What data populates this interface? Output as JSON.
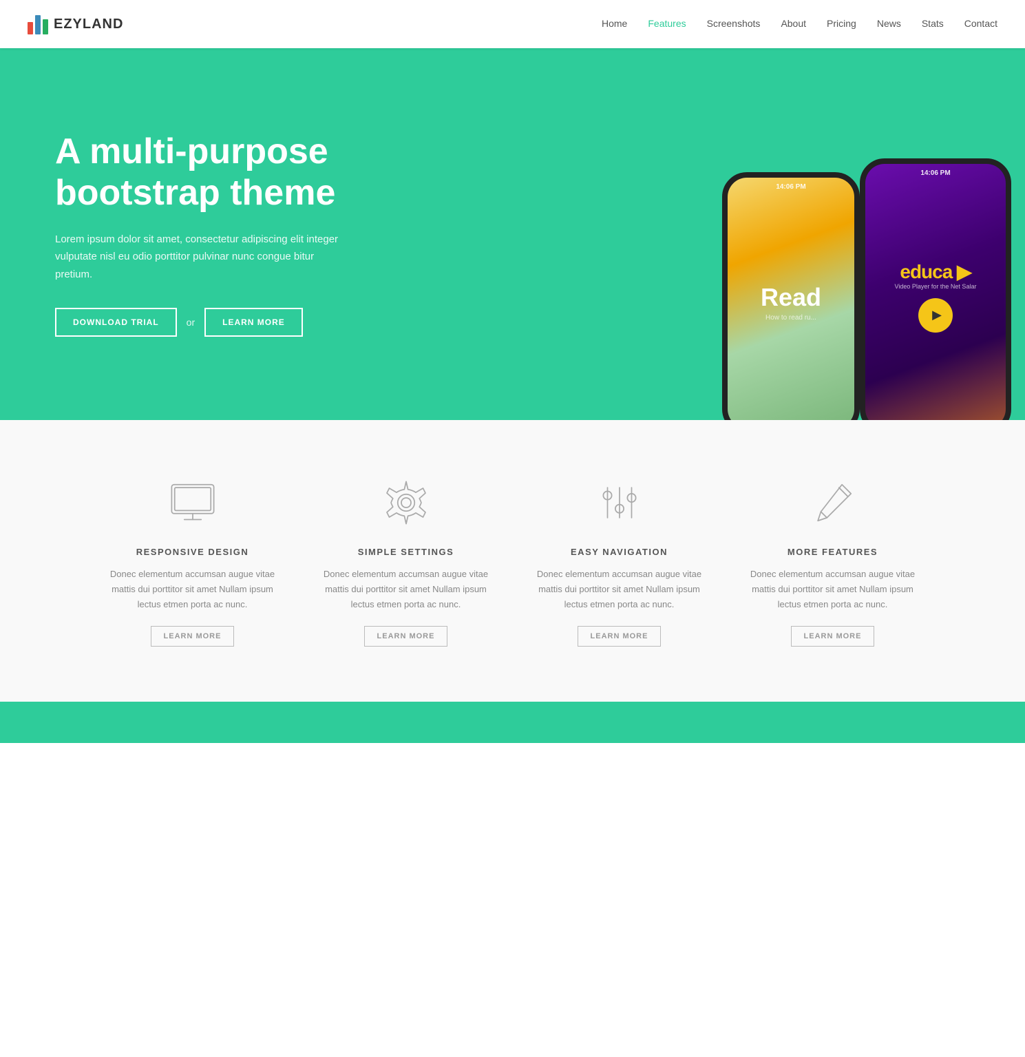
{
  "brand": {
    "name": "EZYLAND"
  },
  "nav": {
    "links": [
      {
        "label": "Home",
        "active": false
      },
      {
        "label": "Features",
        "active": true
      },
      {
        "label": "Screenshots",
        "active": false
      },
      {
        "label": "About",
        "active": false
      },
      {
        "label": "Pricing",
        "active": false
      },
      {
        "label": "News",
        "active": false
      },
      {
        "label": "Stats",
        "active": false
      },
      {
        "label": "Contact",
        "active": false
      }
    ]
  },
  "hero": {
    "title": "A multi-purpose bootstrap theme",
    "description": "Lorem ipsum dolor sit amet, consectetur adipiscing elit integer vulputate nisl eu odio porttitor pulvinar nunc congue bitur pretium.",
    "btn_download": "DOWNLOAD TRIAL",
    "btn_or": "or",
    "btn_learn": "LEARN MORE",
    "phone_time": "14:06 PM"
  },
  "features": {
    "cards": [
      {
        "icon": "monitor",
        "title": "RESPONSIVE DESIGN",
        "description": "Donec elementum accumsan augue vitae mattis dui porttitor sit amet Nullam ipsum lectus etmen porta ac nunc.",
        "btn": "LEARN MORE"
      },
      {
        "icon": "settings",
        "title": "SIMPLE SETTINGS",
        "description": "Donec elementum accumsan augue vitae mattis dui porttitor sit amet Nullam ipsum lectus etmen porta ac nunc.",
        "btn": "LEARN MORE"
      },
      {
        "icon": "sliders",
        "title": "EASY NAVIGATION",
        "description": "Donec elementum accumsan augue vitae mattis dui porttitor sit amet Nullam ipsum lectus etmen porta ac nunc.",
        "btn": "LEARN MORE"
      },
      {
        "icon": "pencil",
        "title": "MORE FEATURES",
        "description": "Donec elementum accumsan augue vitae mattis dui porttitor sit amet Nullam ipsum lectus etmen porta ac nunc.",
        "btn": "LEARN MORE"
      }
    ]
  }
}
